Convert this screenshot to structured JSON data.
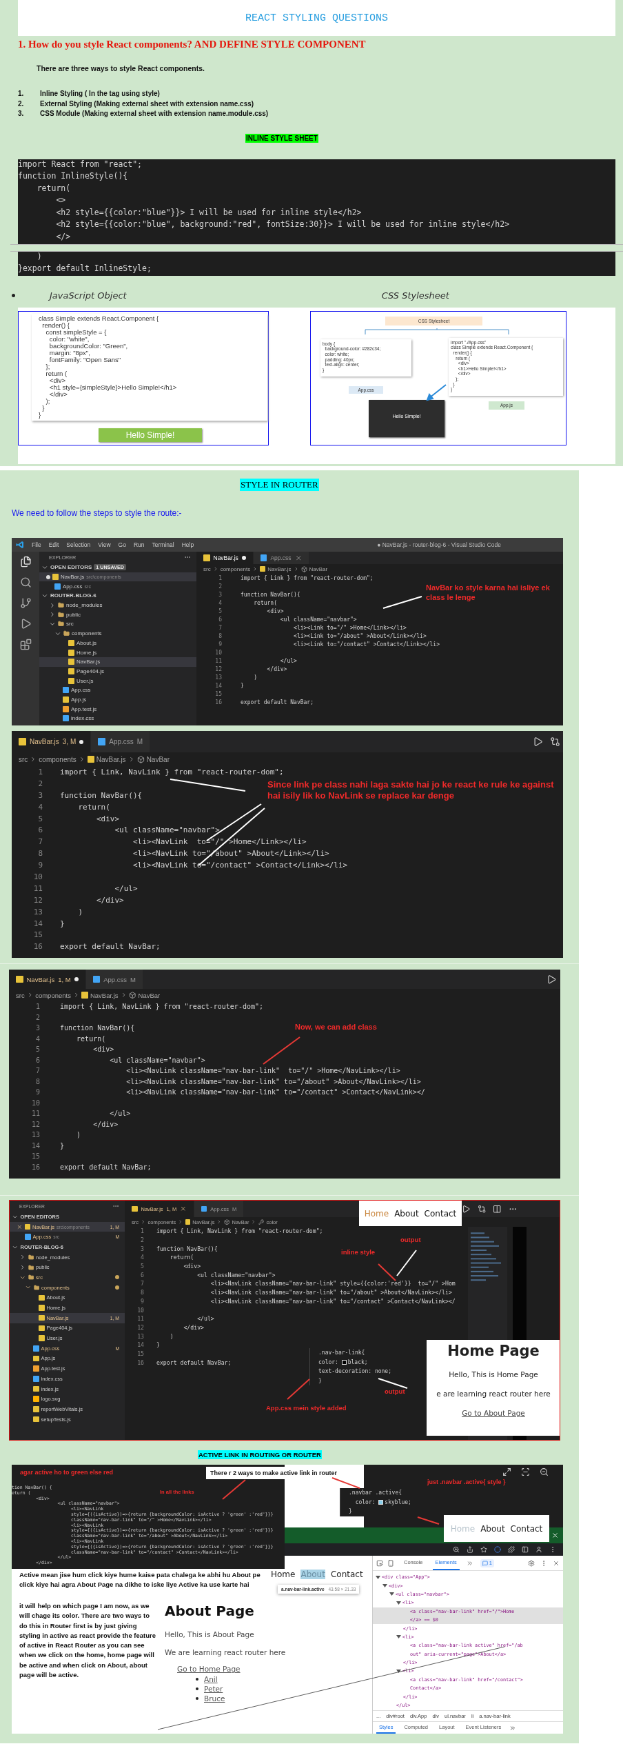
{
  "document_title": "REACT STYLING QUESTIONS",
  "question_heading": "1. How do you style React components? AND DEFINE STYLE COMPONENT",
  "intro": "There are three ways to style React components.",
  "ways": [
    {
      "number": "1.",
      "text": "Inline Styling ( In the tag using style)"
    },
    {
      "number": "2.",
      "text": "External Styling (Making external sheet with extension name.css)"
    },
    {
      "number": "3.",
      "text": "CSS Module (Making external sheet with extension name.module.css)"
    }
  ],
  "inline_heading": "INLINE STYLE SHEET",
  "inline_code": {
    "lines": [
      "import React from \"react\";",
      "function InlineStyle(){",
      "    return(",
      "        <>",
      "        <h2 style={{color:\"blue\"}}> I will be used for inline style</h2>",
      "        <h2 style={{color:\"blue\", background:\"red\", fontSize:30}}> I will be used for inline style</h2>",
      "        </>"
    ],
    "continued_lines": [
      "    )",
      "}export default InlineStyle;"
    ]
  },
  "approaches": [
    "JavaScript Object",
    "CSS Stylesheet"
  ],
  "js_object_image": {
    "code": [
      "class Simple extends React.Component {",
      "  render() {",
      "    const simpleStyle = {",
      "      color: \"white\",",
      "      backgroundColor: \"Green\",",
      "      margin: \"8px\",",
      "      fontFamily: \"Open Sans\"",
      "    };",
      "    return (",
      "      <div>",
      "      <h1 style={simpleStyle}>Hello Simple!</h1>",
      "      </div>",
      "    );",
      "  }",
      "}"
    ],
    "output": "Hello Simple!"
  },
  "css_stylesheet_image": {
    "title": "CSS Stylesheet",
    "css_code": [
      "body {",
      "  background-color: #282c34;",
      "  color: white;",
      "  padding: 40px;",
      "  text-align: center;",
      "}"
    ],
    "css_file": "App.css",
    "js_code": [
      "import \"./App.css\"",
      "class Simple extends React.Component {",
      "  render() {",
      "    return (",
      "      <div>",
      "      <h1>Hello Simple!</h1>",
      "      </div>",
      "    );",
      "  }",
      "}"
    ],
    "js_file": "App.js",
    "output": "Hello Simple!"
  },
  "router_heading": "STYLE IN ROUTER",
  "router_intro": "We need to follow the steps to style the route:-",
  "editor_screenshots": [
    {
      "kind": "window",
      "menu": {
        "items": [
          "File",
          "Edit",
          "Selection",
          "View",
          "Go",
          "Run",
          "Terminal",
          "Help"
        ],
        "title": "● NavBar.js - router-blog-6 - Visual Studio Code"
      },
      "explorer": {
        "title": "EXPLORER",
        "open_editors": {
          "title": "OPEN EDITORS",
          "badge": "1 UNSAVED",
          "expanded": true,
          "items": [
            {
              "label": "NavBar.js",
              "detail": "src\\components",
              "kind": "js",
              "modified": true,
              "selected": true
            },
            {
              "label": "App.css",
              "detail": "src",
              "kind": "css",
              "modified": false,
              "selected": false
            }
          ]
        },
        "project": {
          "title": "ROUTER-BLOG-6",
          "expanded": true,
          "items": [
            {
              "label": "node_modules",
              "kind": "folder",
              "expanded": false,
              "selected": false
            },
            {
              "label": "public",
              "kind": "folder",
              "expanded": false,
              "selected": false
            },
            {
              "label": "src",
              "kind": "folder",
              "expanded": true,
              "selected": false,
              "children": [
                {
                  "label": "components",
                  "kind": "folder",
                  "expanded": true,
                  "selected": false,
                  "children": [
                    {
                      "label": "About.js",
                      "kind": "js",
                      "selected": false
                    },
                    {
                      "label": "Home.js",
                      "kind": "js",
                      "selected": false
                    },
                    {
                      "label": "NavBar.js",
                      "kind": "js",
                      "selected": true
                    },
                    {
                      "label": "Page404.js",
                      "kind": "js",
                      "selected": false
                    },
                    {
                      "label": "User.js",
                      "kind": "js",
                      "selected": false
                    }
                  ]
                },
                {
                  "label": "App.css",
                  "kind": "css",
                  "selected": false
                },
                {
                  "label": "App.js",
                  "kind": "js",
                  "selected": false
                },
                {
                  "label": "App.test.js",
                  "kind": "test",
                  "selected": false
                },
                {
                  "label": "index.css",
                  "kind": "css",
                  "selected": false
                }
              ]
            }
          ]
        }
      },
      "tabs": [
        {
          "label": "NavBar.js",
          "kind": "js",
          "selected": true,
          "modified": true,
          "close_button": false
        },
        {
          "label": "App.css",
          "kind": "css",
          "selected": false,
          "modified": false,
          "close_button": true
        }
      ],
      "breadcrumb": [
        {
          "label": "src",
          "kind": "folder"
        },
        {
          "label": "components",
          "kind": "folder"
        },
        {
          "label": "NavBar.js",
          "kind": "js"
        },
        {
          "label": "NavBar",
          "kind": "symbol"
        }
      ],
      "lines": [
        {
          "number": "1",
          "code": "import { Link } from \"react-router-dom\";"
        },
        {
          "number": "2"
        },
        {
          "number": "3",
          "code": "function NavBar(){"
        },
        {
          "number": "4",
          "code": "    return("
        },
        {
          "number": "5",
          "code": "        <div>"
        },
        {
          "number": "6",
          "code": "            <ul className=\"navbar\">"
        },
        {
          "number": "7",
          "code": "                <li><Link to=\"/\" >Home</Link></li>"
        },
        {
          "number": "8",
          "code": "                <li><Link to=\"/about\" >About</Link></li>"
        },
        {
          "number": "9",
          "code": "                <li><Link to=\"/contact\" >Contact</Link></li>"
        },
        {
          "number": "10"
        },
        {
          "number": "11",
          "code": "            </ul>"
        },
        {
          "number": "12",
          "code": "        </div>"
        },
        {
          "number": "13",
          "code": "    )"
        },
        {
          "number": "14",
          "code": "}"
        },
        {
          "number": "15"
        },
        {
          "number": "16",
          "code": "export default NavBar;"
        }
      ],
      "annotations": [
        "NavBar ko style karna hai isliye ek class le lenge"
      ]
    },
    {
      "kind": "editor",
      "tabs": [
        {
          "label": "NavBar.js",
          "badge": "3, M",
          "kind": "js",
          "selected": true,
          "modified": true,
          "close_button": false
        },
        {
          "label": "App.css",
          "badge": "M",
          "kind": "css",
          "selected": false,
          "modified": false,
          "close_button": false
        }
      ],
      "breadcrumb": [
        {
          "label": "src",
          "kind": "folder"
        },
        {
          "label": "components",
          "kind": "folder"
        },
        {
          "label": "NavBar.js",
          "kind": "js"
        },
        {
          "label": "NavBar",
          "kind": "symbol"
        }
      ],
      "lines": [
        {
          "number": "1",
          "code": "import { Link, NavLink } from \"react-router-dom\";"
        },
        {
          "number": "2"
        },
        {
          "number": "3",
          "code": "function NavBar(){"
        },
        {
          "number": "4",
          "code": "    return("
        },
        {
          "number": "5",
          "code": "        <div>"
        },
        {
          "number": "6",
          "code": "            <ul className=\"navbar\">"
        },
        {
          "number": "7",
          "code": "                <li><NavLink  to=\"/\" >Home</Link></li>"
        },
        {
          "number": "8",
          "code": "                <li><NavLink to=\"/about\" >About</Link></li>"
        },
        {
          "number": "9",
          "code": "                <li><NavLink to=\"/contact\" >Contact</Link></li>"
        },
        {
          "number": "10"
        },
        {
          "number": "11",
          "code": "            </ul>"
        },
        {
          "number": "12",
          "code": "        </div>"
        },
        {
          "number": "13",
          "code": "    )"
        },
        {
          "number": "14",
          "code": "}"
        },
        {
          "number": "15"
        },
        {
          "number": "16",
          "code": "export default NavBar;"
        }
      ],
      "annotations": [
        "Since link pe class nahi laga sakte hai jo ke react ke rule ke against hai isily lik ko NavLink se replace kar denge"
      ]
    },
    {
      "kind": "editor_small",
      "tabs": [
        {
          "label": "NavBar.js",
          "badge": "1, M",
          "kind": "js",
          "selected": true,
          "modified": true,
          "close_button": false
        },
        {
          "label": "App.css",
          "badge": "M",
          "kind": "css",
          "selected": false,
          "modified": false,
          "close_button": false
        }
      ],
      "breadcrumb": [
        {
          "label": "src",
          "kind": "folder"
        },
        {
          "label": "components",
          "kind": "folder"
        },
        {
          "label": "NavBar.js",
          "kind": "js"
        },
        {
          "label": "NavBar",
          "kind": "symbol"
        }
      ],
      "lines": [
        {
          "number": "1",
          "code": "import { Link, NavLink } from \"react-router-dom\";"
        },
        {
          "number": "2"
        },
        {
          "number": "3",
          "code": "function NavBar(){"
        },
        {
          "number": "4",
          "code": "    return("
        },
        {
          "number": "5",
          "code": "        <div>"
        },
        {
          "number": "6",
          "code": "            <ul className=\"navbar\">"
        },
        {
          "number": "7",
          "code": "                <li><NavLink className=\"nav-bar-link\"  to=\"/\" >Home</NavLink></li>"
        },
        {
          "number": "8",
          "code": "                <li><NavLink className=\"nav-bar-link\" to=\"/about\" >About</NavLink></li>"
        },
        {
          "number": "9",
          "code": "                <li><NavLink className=\"nav-bar-link\" to=\"/contact\" >Contact</NavLink></"
        },
        {
          "number": "10"
        },
        {
          "number": "11",
          "code": "            </ul>"
        },
        {
          "number": "12",
          "code": "        </div>"
        },
        {
          "number": "13",
          "code": "    )"
        },
        {
          "number": "14",
          "code": "}"
        },
        {
          "number": "15"
        },
        {
          "number": "16",
          "code": "export default NavBar;"
        }
      ],
      "annotations": [
        "Now, we can add class"
      ]
    },
    {
      "kind": "workspace",
      "explorer": {
        "title": "EXPLORER",
        "open_editors": {
          "title": "OPEN EDITORS",
          "expanded": true,
          "items": [
            {
              "label": "NavBar.js",
              "detail": "src\\components",
              "badge": "1, M",
              "kind": "js",
              "modified": false,
              "hovered": true,
              "selected": true
            },
            {
              "label": "App.css",
              "detail": "src",
              "badge": "M",
              "kind": "css",
              "modified": false,
              "selected": false
            }
          ]
        },
        "project": {
          "title": "ROUTER-BLOG-6",
          "expanded": true,
          "items": [
            {
              "label": "node_modules",
              "kind": "folder",
              "expanded": false,
              "selected": false
            },
            {
              "label": "public",
              "kind": "folder",
              "expanded": false,
              "selected": false
            },
            {
              "label": "src",
              "kind": "folder",
              "expanded": true,
              "modified": true,
              "selected": false,
              "children": [
                {
                  "label": "components",
                  "kind": "folder",
                  "expanded": true,
                  "modified": true,
                  "selected": false,
                  "children": [
                    {
                      "label": "About.js",
                      "kind": "js",
                      "selected": false
                    },
                    {
                      "label": "Home.js",
                      "kind": "js",
                      "selected": false
                    },
                    {
                      "label": "NavBar.js",
                      "kind": "js",
                      "badge": "1, M",
                      "selected": true
                    },
                    {
                      "label": "Page404.js",
                      "kind": "js",
                      "selected": false
                    },
                    {
                      "label": "User.js",
                      "kind": "js",
                      "selected": false
                    }
                  ]
                },
                {
                  "label": "App.css",
                  "kind": "css",
                  "badge": "M",
                  "selected": false
                },
                {
                  "label": "App.js",
                  "kind": "js",
                  "selected": false
                },
                {
                  "label": "App.test.js",
                  "kind": "test",
                  "selected": false
                },
                {
                  "label": "index.css",
                  "kind": "css",
                  "selected": false
                },
                {
                  "label": "index.js",
                  "kind": "js",
                  "selected": false
                },
                {
                  "label": "logo.svg",
                  "kind": "svg",
                  "selected": false
                },
                {
                  "label": "reportWebVitals.js",
                  "kind": "js",
                  "selected": false
                },
                {
                  "label": "setupTests.js",
                  "kind": "js",
                  "selected": false
                }
              ]
            }
          ]
        }
      },
      "tabs": [
        {
          "label": "NavBar.js",
          "badge": "1, M",
          "kind": "js",
          "selected": true,
          "modified": false,
          "close_button": true
        },
        {
          "label": "App.css",
          "badge": "M",
          "kind": "css",
          "selected": false,
          "modified": false,
          "close_button": false
        }
      ],
      "breadcrumb": [
        {
          "label": "src",
          "kind": "folder"
        },
        {
          "label": "components",
          "kind": "folder"
        },
        {
          "label": "NavBar.js",
          "kind": "js"
        },
        {
          "label": "NavBar",
          "kind": "symbol"
        },
        {
          "label": "color",
          "kind": "property"
        }
      ],
      "lines": [
        {
          "number": "1",
          "code": "import { Link, NavLink } from \"react-router-dom\";"
        },
        {
          "number": "2"
        },
        {
          "number": "3",
          "code": "function NavBar(){"
        },
        {
          "number": "4",
          "code": "    return("
        },
        {
          "number": "5",
          "code": "        <div>"
        },
        {
          "number": "6",
          "code": "            <ul className=\"navbar\">"
        },
        {
          "number": "7",
          "code": "                <li><NavLink className=\"nav-bar-link\" style={{color:'red'}}  to=\"/\" >Hom"
        },
        {
          "number": "8",
          "code": "                <li><NavLink className=\"nav-bar-link\" to=\"/about\" >About</NavLink></li>"
        },
        {
          "number": "9",
          "code": "                <li><NavLink className=\"nav-bar-link\" to=\"/contact\" >Contact</NavLink></"
        },
        {
          "number": "10"
        },
        {
          "number": "11",
          "code": "            </ul>"
        },
        {
          "number": "12",
          "code": "        </div>"
        },
        {
          "number": "13",
          "code": "    )"
        },
        {
          "number": "14",
          "code": "}"
        },
        {
          "number": "15"
        },
        {
          "number": "16",
          "code": "export default NavBar;"
        }
      ],
      "annotations": [
        "output",
        "inline style",
        "output",
        "App.css mein style added"
      ],
      "css_snippet": [
        {
          "text": ".nav-bar-link{"
        },
        {
          "text": "color: ",
          "swatch": true,
          "value": "black;"
        },
        {
          "text": "text-decoration: none;"
        },
        {
          "text": "}"
        }
      ],
      "output_nav": [
        {
          "label": "Home",
          "selected": true
        },
        {
          "label": "About",
          "selected": false
        },
        {
          "label": "Contact",
          "selected": false
        }
      ],
      "output_page": {
        "heading": "Home Page",
        "text": "Hello, This is Home Page",
        "subtext": "e are learning react router here",
        "link": "Go to About Page"
      }
    }
  ],
  "active_heading": "ACTIVE LINK IN ROUTING OR ROUTER",
  "active_collage": {
    "code_note": "agar active ho to green else red",
    "links_note": "In all the links",
    "code": [
      "tion NavBar() {",
      "eturn (",
      "         <div>",
      "                 <ul className=\"navbar\">",
      "                      <li><NavLink",
      "                      style={({isActive})=>{return {backgroundColor: isActive ? 'green' :'red'}}}",
      "                      className=\"nav-bar-link\" to=\"/\" >Home</NavLink></li>",
      "                      <li><NavLink",
      "                      style={({isActive})=>{return {backgroundColor: isActive ? 'green' :'red'}}}",
      "                      className=\"nav-bar-link\" to=\"/about\" >About</NavLink></li>",
      "                      <li><NavLink",
      "                      style={({isActive})=>{return {backgroundColor: isActive ? 'green' :'red'}}}",
      "                      className=\"nav-bar-link\" to=\"/contact\" >Contact</NavLink></li>",
      "                 </ul>",
      "         </div>"
    ],
    "ways_note": "There r 2 ways to make active link in router",
    "css_note": "just .navbar .active{ style }",
    "css_code": [
      {
        "text": ".navbar .active{"
      },
      {
        "text": "  color: ",
        "swatch": true,
        "value": "skyblue;"
      },
      {
        "text": "}"
      }
    ],
    "nav_links": [
      {
        "label": "Home",
        "selected": true
      },
      {
        "label": "About",
        "selected": false
      },
      {
        "label": "Contact",
        "selected": false
      }
    ],
    "explanation": [
      "Active mean jise hum click kiye hume kaise pata chalega ke abhi hu About pe click kiye hai agra About Page na dikhe to iske liye Active ka use karte hai",
      "it will help on which page I am now, as we will chage its color. There are two ways to do this in Router first is by just giving styling in active as react provide the feature of active in React Router as  you can see when we click on the home, home page will be active and when click on About, about page will be active."
    ],
    "page_nav": [
      {
        "label": "Home",
        "selected": false
      },
      {
        "label": "About",
        "selected": true
      },
      {
        "label": "Contact",
        "selected": false
      }
    ],
    "tooltip": {
      "selector": "a.nav-bar-link.active",
      "size": "43.58 × 21.33"
    },
    "page": {
      "heading": "About Page",
      "text": "Hello, This is About Page",
      "subtext": "We are learning react router here",
      "link": "Go to Home Page",
      "list": [
        "Anil",
        "Peter",
        "Bruce"
      ]
    },
    "devtools": {
      "tabs": [
        {
          "label": "Console",
          "selected": false
        },
        {
          "label": "Elements",
          "selected": true
        }
      ],
      "issues": "1",
      "dom": [
        {
          "open": "<div class=\"App\">",
          "expanded": true,
          "selected": false,
          "children": [
            {
              "open": "<div>",
              "expanded": true,
              "selected": false,
              "children": [
                {
                  "open": "<ul class=\"navbar\">",
                  "expanded": true,
                  "selected": false,
                  "close": "</ul>",
                  "children": [
                    {
                      "open": "<li>",
                      "expanded": true,
                      "selected": false,
                      "close": "</li>",
                      "children": [
                        {
                          "lines": [
                            "<a class=\"nav-bar-link\" href=\"/\">Home",
                            "</a> == $0"
                          ],
                          "selected": true
                        }
                      ]
                    },
                    {
                      "open": "<li>",
                      "expanded": true,
                      "selected": false,
                      "close": "</li>",
                      "children": [
                        {
                          "lines": [
                            "<a class=\"nav-bar-link active\" href=\"/ab",
                            "out\" aria-current=\"page\">About</a>"
                          ],
                          "selected": false
                        }
                      ]
                    },
                    {
                      "open": "<li>",
                      "expanded": true,
                      "selected": false,
                      "close": "</li>",
                      "children": [
                        {
                          "lines": [
                            "<a class=\"nav-bar-link\" href=\"/contact\">",
                            "Contact</a>"
                          ],
                          "selected": false
                        }
                      ]
                    }
                  ]
                }
              ]
            }
          ]
        }
      ],
      "breadcrumb": [
        "...",
        "div#root",
        "div.App",
        "div",
        "ul.navbar",
        "li",
        "a.nav-bar-link"
      ],
      "panes": [
        {
          "label": "Styles",
          "selected": true
        },
        {
          "label": "Computed",
          "selected": false
        },
        {
          "label": "Layout",
          "selected": false
        },
        {
          "label": "Event Listeners",
          "selected": false
        }
      ]
    }
  }
}
